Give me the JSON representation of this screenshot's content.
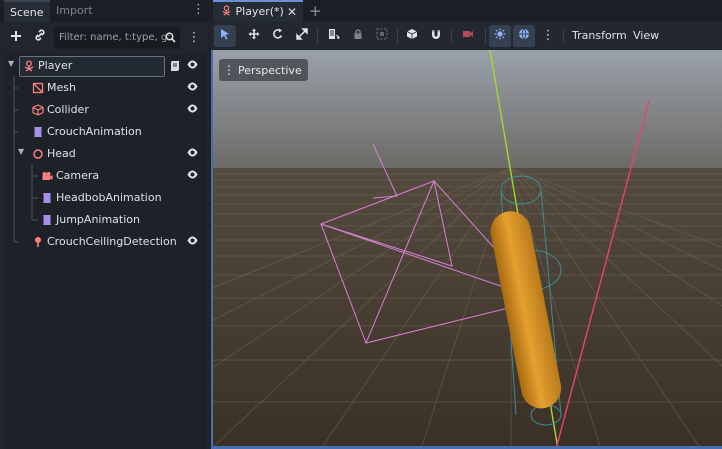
{
  "left_panel": {
    "tabs": {
      "scene": "Scene",
      "import": "Import"
    },
    "filter_placeholder": "Filter: name, t:type, g:",
    "tree": [
      {
        "name": "Player",
        "icon": "player-icon",
        "depth": 0,
        "visible": true,
        "selected": true
      },
      {
        "name": "Mesh",
        "icon": "mesh-icon",
        "depth": 1,
        "visible": true
      },
      {
        "name": "Collider",
        "icon": "collider-icon",
        "depth": 1,
        "visible": true
      },
      {
        "name": "CrouchAnimation",
        "icon": "animation-icon",
        "depth": 1,
        "visible": false
      },
      {
        "name": "Head",
        "icon": "node3d-icon",
        "depth": 1,
        "visible": true,
        "expanded": true
      },
      {
        "name": "Camera",
        "icon": "camera-icon",
        "depth": 2,
        "visible": true
      },
      {
        "name": "HeadbobAnimation",
        "icon": "animation-icon",
        "depth": 2,
        "visible": false
      },
      {
        "name": "JumpAnimation",
        "icon": "animation-icon",
        "depth": 2,
        "visible": false
      },
      {
        "name": "CrouchCeilingDetection",
        "icon": "raycast-icon",
        "depth": 1,
        "visible": true
      }
    ]
  },
  "editor": {
    "tab_title": "Player(*)",
    "tab_close": "✕",
    "tab_add": "+",
    "menus": {
      "transform": "Transform",
      "view": "View"
    },
    "viewport_label": "Perspective"
  },
  "colors": {
    "accent": "#6d8fd6",
    "player_icon": "#fc7f7f",
    "animation_icon": "#a68fe8",
    "capsule": "#e5a02f"
  }
}
